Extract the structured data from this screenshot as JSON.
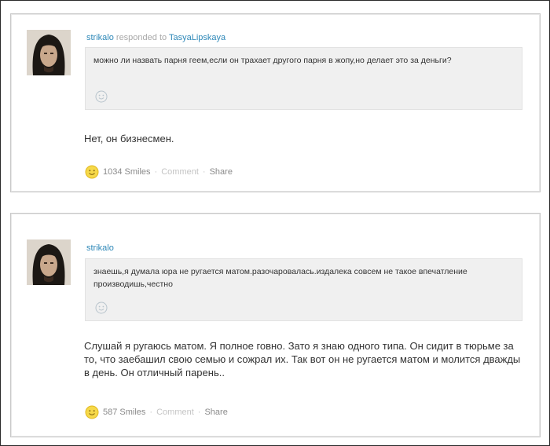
{
  "posts": [
    {
      "author": "strikalo",
      "responded_to_label": "responded to",
      "responded_to_user": "TasyaLipskaya",
      "quote": "можно ли назвать парня геем,если он трахает другого парня в жопу,но делает это за деньги?",
      "answer": "Нет, он бизнесмен.",
      "smiles": "1034 Smiles",
      "comment": "Comment",
      "share": "Share"
    },
    {
      "author": "strikalo",
      "quote": "знаешь,я думала юра не ругается матом.разочаровалась.издалека совсем не такое впечатление производишь,честно",
      "answer": "Слушай я ругаюсь матом. Я полное говно. Зато я знаю одного типа. Он сидит в тюрьме за то, что заебашил свою семью и сожрал их. Так вот он не ругается матом и молится дважды в день. Он отличный парень..",
      "smiles": "587 Smiles",
      "comment": "Comment",
      "share": "Share"
    }
  ],
  "colors": {
    "link": "#2e88b8",
    "muted": "#a8a8a8",
    "quote_bg": "#f0f0f0",
    "smiley": "#f4d03f"
  },
  "icons": [
    "avatar-photo",
    "smiley-icon",
    "smiles-icon"
  ],
  "separator": "·"
}
